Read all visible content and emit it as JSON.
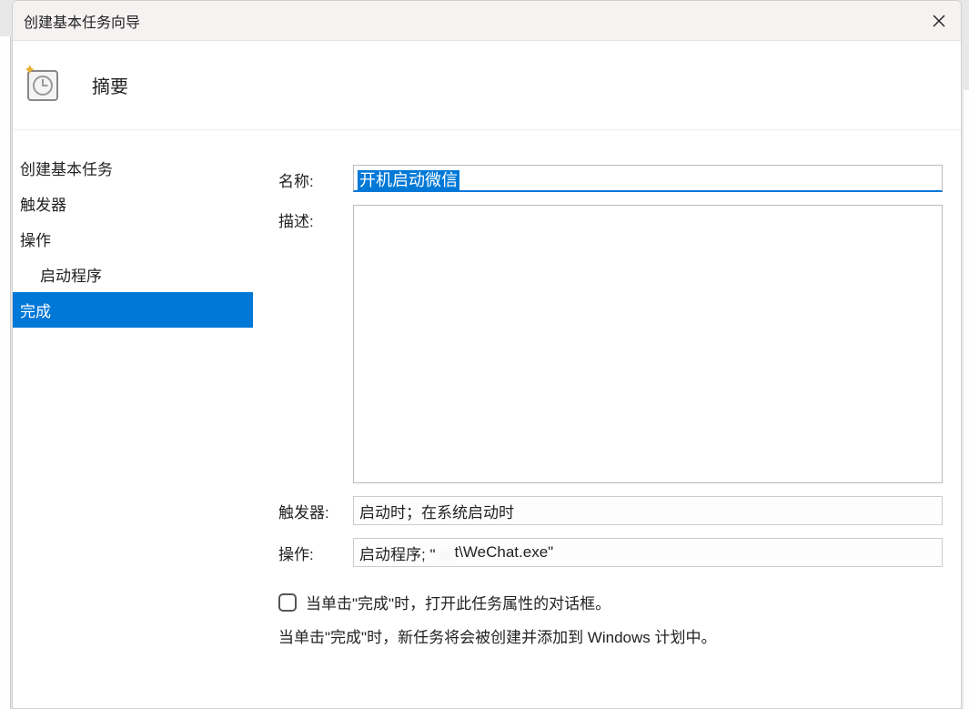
{
  "window": {
    "title": "创建基本任务向导"
  },
  "header": {
    "title": "摘要"
  },
  "sidebar": {
    "items": [
      {
        "label": "创建基本任务",
        "active": false,
        "indent": false
      },
      {
        "label": "触发器",
        "active": false,
        "indent": false
      },
      {
        "label": "操作",
        "active": false,
        "indent": false
      },
      {
        "label": "启动程序",
        "active": false,
        "indent": true
      },
      {
        "label": "完成",
        "active": true,
        "indent": false
      }
    ]
  },
  "form": {
    "name_label": "名称:",
    "name_value": "开机启动微信",
    "desc_label": "描述:",
    "desc_value": "",
    "trigger_label": "触发器:",
    "trigger_value": "启动时；在系统启动时",
    "action_label": "操作:",
    "action_prefix": "启动程序; \"",
    "action_blurred": "…",
    "action_suffix": "t\\WeChat.exe\"",
    "checkbox_label": "当单击\"完成\"时，打开此任务属性的对话框。",
    "info_text": "当单击\"完成\"时，新任务将会被创建并添加到 Windows 计划中。"
  }
}
